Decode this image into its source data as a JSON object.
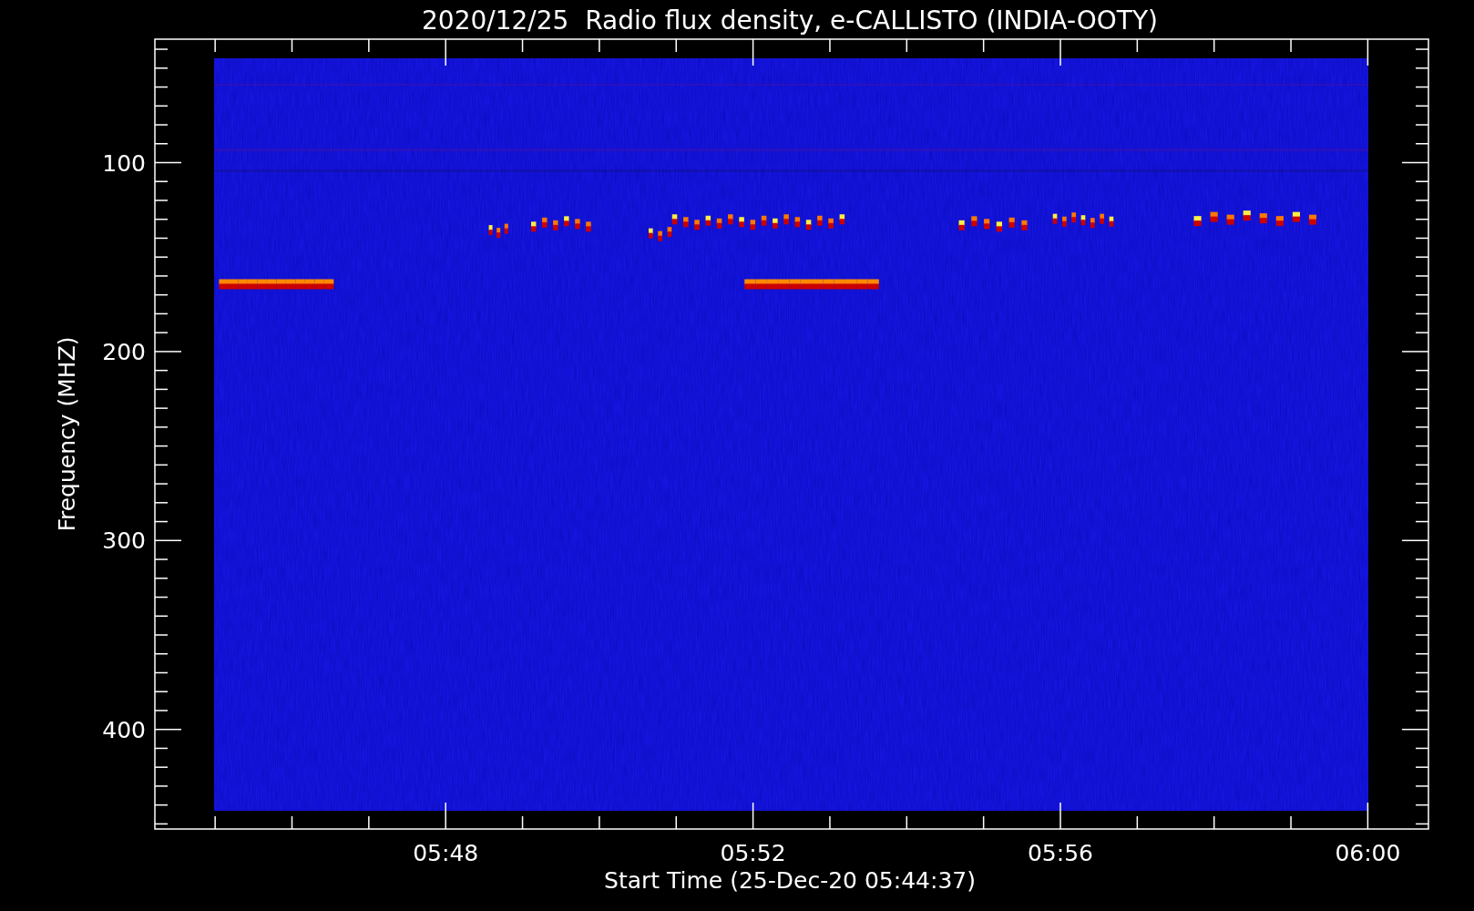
{
  "plot": {
    "title": "2020/12/25  Radio flux density, e-CALLISTO (INDIA-OOTY)",
    "ylabel": "Frequency (MHZ)",
    "xlabel": "Start Time (25-Dec-20 05:44:37)",
    "yticks": [
      {
        "label": "100"
      },
      {
        "label": "200"
      },
      {
        "label": "300"
      },
      {
        "label": "400"
      }
    ],
    "xticks": [
      {
        "label": "05:48"
      },
      {
        "label": "05:52"
      },
      {
        "label": "05:56"
      },
      {
        "label": "06:00"
      }
    ]
  }
}
